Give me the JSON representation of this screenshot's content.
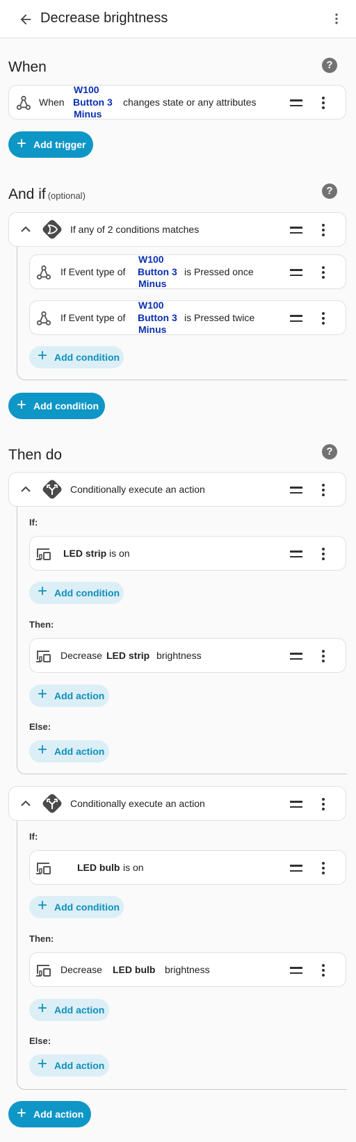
{
  "header": {
    "title": "Decrease brightness"
  },
  "when": {
    "heading": "When",
    "trigger": {
      "prefix": "When",
      "entity_line1": "W100",
      "entity_line2": "Button 3",
      "entity_line3": "Minus",
      "suffix": "changes state or any attributes"
    },
    "add_trigger": "Add trigger"
  },
  "and_if": {
    "heading": "And if",
    "optional": "(optional)",
    "group_label": "If any of 2 conditions matches",
    "conditions": [
      {
        "prefix": "If Event type of",
        "entity_line1": "W100",
        "entity_line2": "Button 3",
        "entity_line3": "Minus",
        "suffix": "is Pressed once"
      },
      {
        "prefix": "If Event type of",
        "entity_line1": "W100",
        "entity_line2": "Button 3",
        "entity_line3": "Minus",
        "suffix": "is Pressed twice"
      }
    ],
    "inner_add_condition": "Add condition",
    "add_condition": "Add condition"
  },
  "then_do": {
    "heading": "Then do",
    "blocks": [
      {
        "label": "Conditionally execute an action",
        "if_label": "If:",
        "if_entity": "LED strip",
        "if_state": "is on",
        "add_condition": "Add condition",
        "then_label": "Then:",
        "then_prefix": "Decrease",
        "then_entity": "LED strip",
        "then_suffix": "brightness",
        "add_action_then": "Add action",
        "else_label": "Else:",
        "add_action_else": "Add action"
      },
      {
        "label": "Conditionally execute an action",
        "if_label": "If:",
        "if_entity": "LED bulb",
        "if_state": "is on",
        "add_condition": "Add condition",
        "then_label": "Then:",
        "then_prefix": "Decrease",
        "then_entity": "LED bulb",
        "then_suffix": "brightness",
        "add_action_then": "Add action",
        "else_label": "Else:",
        "add_action_else": "Add action"
      }
    ],
    "add_action": "Add action"
  },
  "icons": {
    "back": "arrow-left-icon",
    "menu": "dots-vertical-icon",
    "help": "help-circle-icon",
    "trigger": "graph-nodes-icon",
    "condition_group": "or-gate-icon",
    "choose": "call-split-icon",
    "device": "devices-icon",
    "drag": "drag-handle-icon",
    "expand": "chevron-up-icon"
  },
  "colors": {
    "accent": "#0e96c6",
    "entity": "#0b2fb0",
    "soft_button": "#dceff6"
  }
}
